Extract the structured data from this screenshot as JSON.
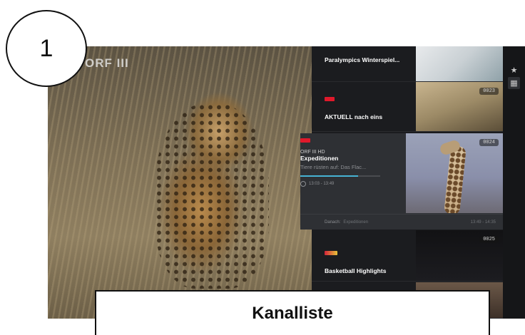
{
  "step": "1",
  "caption": "Kanalliste",
  "player": {
    "channel_logo": "ORF III"
  },
  "channels": [
    {
      "title": "Paralympics Winterspiel...",
      "logo_color": "#e0192b"
    },
    {
      "title": "AKTUELL nach eins",
      "number": "0023",
      "logo_color": "#e0192b"
    },
    {
      "channel_name": "ORF III HD",
      "title": "Expeditionen",
      "episode": "Tiere rüsten auf: Das Flac...",
      "progress": 0.72,
      "time": "13:03 - 13:49",
      "number": "0024",
      "next_label": "Danach:",
      "next_title": "Expeditionen",
      "next_time": "13:49 - 14:35",
      "logo_color": "#e0192b"
    },
    {
      "title": "Basketball Highlights",
      "number": "0025",
      "logo_color": "#d4233a"
    }
  ],
  "rail": {
    "favorite_icon": "★",
    "list_icon": "▦"
  }
}
